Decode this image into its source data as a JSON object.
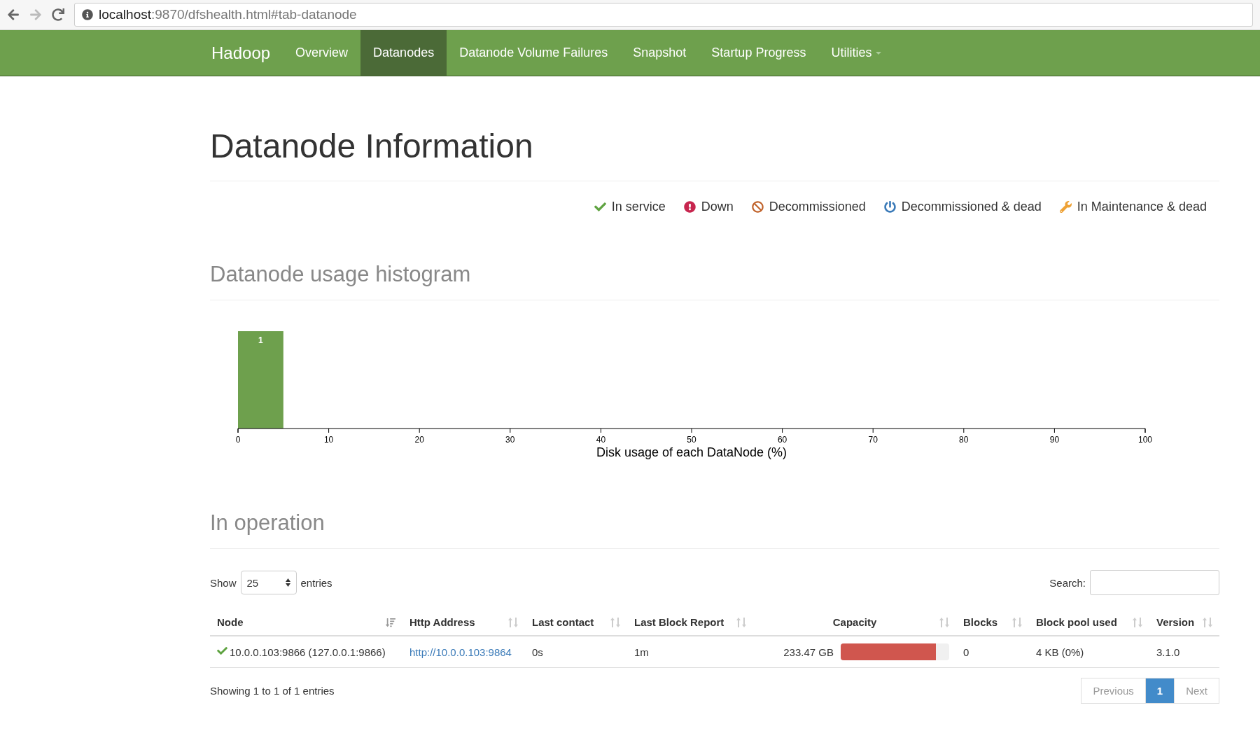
{
  "browser": {
    "host": "localhost",
    "path": ":9870/dfshealth.html#tab-datanode"
  },
  "navbar": {
    "brand": "Hadoop",
    "items": [
      {
        "label": "Overview",
        "selected": false,
        "dropdown": false
      },
      {
        "label": "Datanodes",
        "selected": true,
        "dropdown": false
      },
      {
        "label": "Datanode Volume Failures",
        "selected": false,
        "dropdown": false
      },
      {
        "label": "Snapshot",
        "selected": false,
        "dropdown": false
      },
      {
        "label": "Startup Progress",
        "selected": false,
        "dropdown": false
      },
      {
        "label": "Utilities",
        "selected": false,
        "dropdown": true
      }
    ]
  },
  "page_title": "Datanode Information",
  "legend": [
    {
      "kind": "check",
      "label": "In service",
      "color": "#5fa341"
    },
    {
      "kind": "alert",
      "label": "Down",
      "color": "#c7254e"
    },
    {
      "kind": "ban",
      "label": "Decommissioned",
      "color": "#c0622a"
    },
    {
      "kind": "power",
      "label": "Decommissioned & dead",
      "color": "#3a7ab8"
    },
    {
      "kind": "wrench",
      "label": "In Maintenance & dead",
      "color": "#eea236"
    }
  ],
  "histogram": {
    "heading": "Datanode usage histogram",
    "chart_data": {
      "type": "bar",
      "xlabel": "Disk usage of each DataNode (%)",
      "x": [
        2.5
      ],
      "values": [
        1
      ],
      "xlim": [
        0,
        100
      ],
      "xticks": [
        0,
        10,
        20,
        30,
        40,
        50,
        60,
        70,
        80,
        90,
        100
      ],
      "data_labels": true
    }
  },
  "in_operation": {
    "heading": "In operation",
    "show_label": "Show",
    "page_size": "25",
    "entries_label": "entries",
    "search_label": "Search:",
    "columns": [
      {
        "label": "Node",
        "sorted": true
      },
      {
        "label": "Http Address",
        "sorted": false
      },
      {
        "label": "Last contact",
        "sorted": false
      },
      {
        "label": "Last Block Report",
        "sorted": false
      },
      {
        "label": "Capacity",
        "sorted": false
      },
      {
        "label": "Blocks",
        "sorted": false
      },
      {
        "label": "Block pool used",
        "sorted": false
      },
      {
        "label": "Version",
        "sorted": false
      }
    ],
    "rows": [
      {
        "in_service": true,
        "node": "10.0.0.103:9866 (127.0.0.1:9866)",
        "http_address": "http://10.0.0.103:9864",
        "last_contact": "0s",
        "last_block_report": "1m",
        "capacity": "233.47 GB",
        "capacity_bar": {
          "level": 0.88
        },
        "blocks": "0",
        "block_pool_used": "4 KB (0%)",
        "version": "3.1.0"
      }
    ],
    "info": "Showing 1 to 1 of 1 entries",
    "pagination": [
      {
        "label": "Previous",
        "selected": false,
        "disabled": true
      },
      {
        "label": "1",
        "selected": true,
        "disabled": false
      },
      {
        "label": "Next",
        "selected": false,
        "disabled": true
      }
    ]
  }
}
